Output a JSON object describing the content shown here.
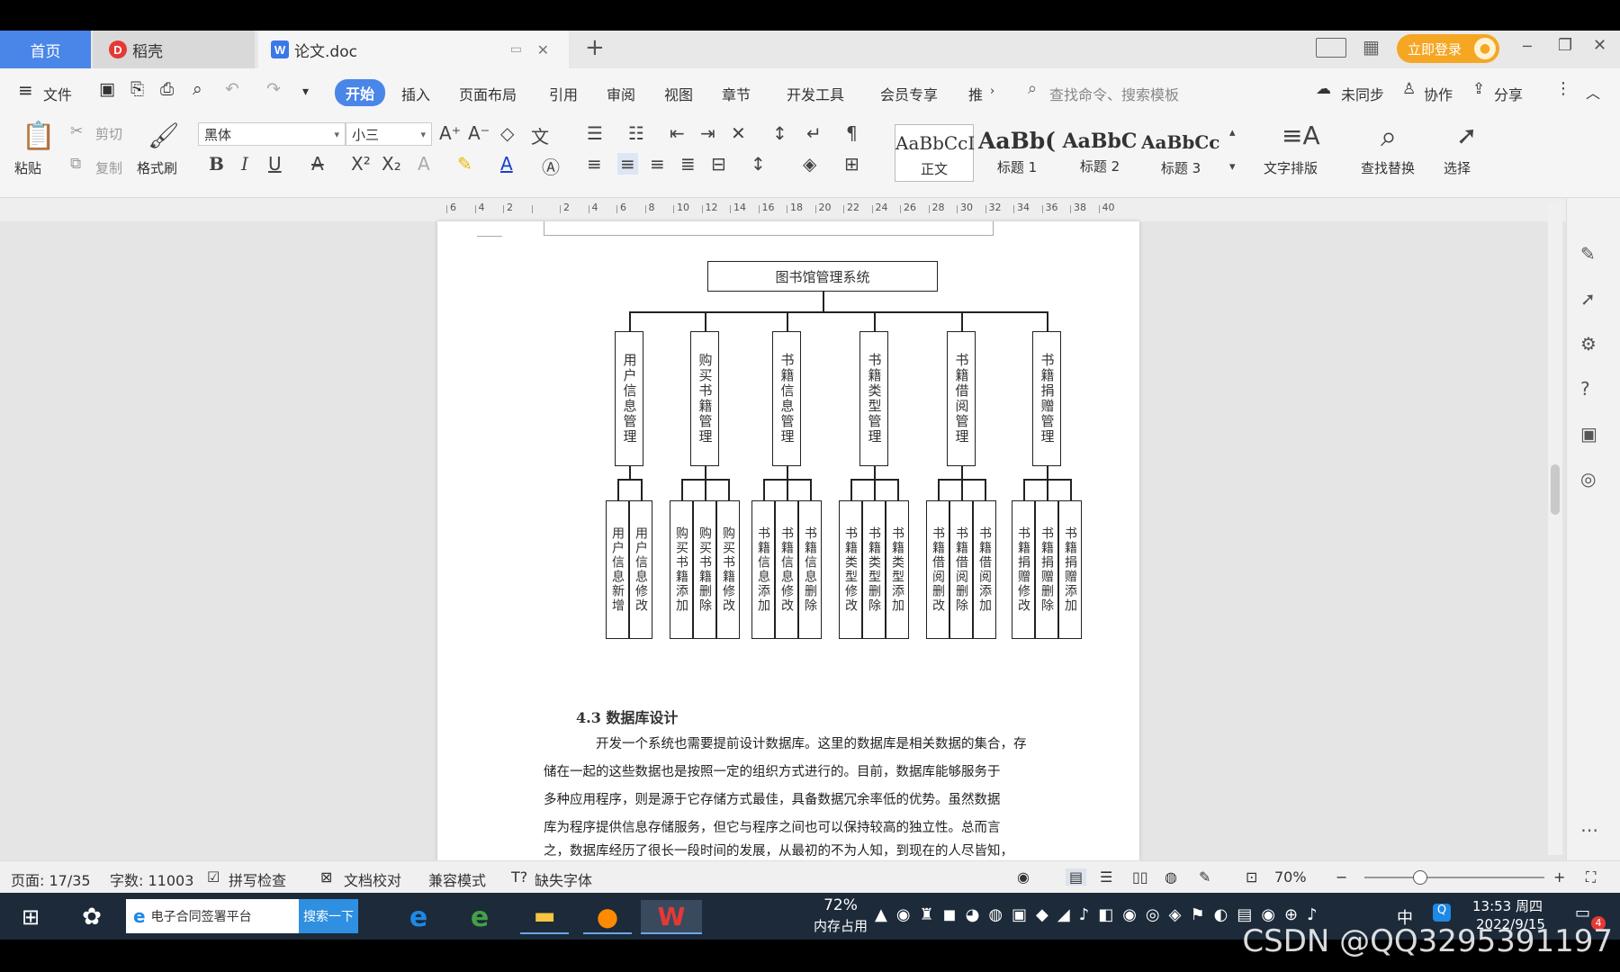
{
  "tabs": {
    "home": "首页",
    "daoke": "稻壳",
    "doc": "论文.doc",
    "new_tab": "+"
  },
  "window": {
    "login": "立即登录",
    "minimize": "─",
    "restore": "❐",
    "close": "✕"
  },
  "menu": {
    "file": "文件",
    "items": [
      "开始",
      "插入",
      "页面布局",
      "引用",
      "审阅",
      "视图",
      "章节",
      "开发工具",
      "会员专享",
      "推"
    ],
    "search_placeholder": "查找命令、搜索模板",
    "sync": "未同步",
    "collab": "协作",
    "share": "分享"
  },
  "ribbon": {
    "paste": "粘贴",
    "cut": "剪切",
    "copy": "复制",
    "format_painter": "格式刷",
    "font_name": "黑体",
    "font_size": "小三",
    "styles": [
      {
        "preview": "AaBbCcI",
        "name": "正文"
      },
      {
        "preview": "AaBb(",
        "name": "标题 1"
      },
      {
        "preview": "AaBbC",
        "name": "标题 2"
      },
      {
        "preview": "AaBbCcl",
        "name": "标题 3"
      }
    ],
    "text_layout": "文字排版",
    "find_replace": "查找替换",
    "select": "选择"
  },
  "ruler": {
    "ticks": [
      "6",
      "4",
      "2",
      "",
      "2",
      "4",
      "6",
      "8",
      "10",
      "12",
      "14",
      "16",
      "18",
      "20",
      "22",
      "24",
      "26",
      "28",
      "30",
      "32",
      "34",
      "36",
      "38",
      "40"
    ]
  },
  "diagram": {
    "root": "图书馆管理系统",
    "modules": [
      {
        "name": "用户信息管理",
        "children": [
          "用户信息新增",
          "用户信息修改"
        ]
      },
      {
        "name": "购买书籍管理",
        "children": [
          "购买书籍添加",
          "购买书籍删除",
          "购买书籍修改"
        ]
      },
      {
        "name": "书籍信息管理",
        "children": [
          "书籍信息添加",
          "书籍信息修改",
          "书籍信息删除"
        ]
      },
      {
        "name": "书籍类型管理",
        "children": [
          "书籍类型修改",
          "书籍类型删除",
          "书籍类型添加"
        ]
      },
      {
        "name": "书籍借阅管理",
        "children": [
          "书籍借阅删改",
          "书籍借阅删除",
          "书籍借阅添加"
        ]
      },
      {
        "name": "书籍捐赠管理",
        "children": [
          "书籍捐赠修改",
          "书籍捐赠删除",
          "书籍捐赠添加"
        ]
      }
    ]
  },
  "document": {
    "heading": "4.3  数据库设计",
    "lines": [
      "开发一个系统也需要提前设计数据库。这里的数据库是相关数据的集合，存",
      "储在一起的这些数据也是按照一定的组织方式进行的。目前，数据库能够服务于",
      "多种应用程序，则是源于它存储方式最佳，具备数据冗余率低的优势。虽然数据",
      "库为程序提供信息存储服务，但它与程序之间也可以保持较高的独立性。总而言",
      "之，数据库经历了很长一段时间的发展，从最初的不为人知，到现在的人尽皆知，"
    ]
  },
  "status": {
    "page": "页面: 17/35",
    "words": "字数: 11003",
    "spell": "拼写检查",
    "proof": "文档校对",
    "compat": "兼容模式",
    "missing_font": "缺失字体",
    "zoom": "70%"
  },
  "taskbar": {
    "search_text": "电子合同签署平台",
    "search_button": "搜索一下",
    "mem_percent": "72%",
    "mem_label": "内存占用",
    "ime": "中",
    "time": "13:53 周四",
    "date": "2022/9/15",
    "notif_count": "4"
  },
  "watermark": "CSDN @QQ3295391197",
  "colors": {
    "accent": "#4a86e8",
    "login": "#f5a623",
    "taskbar": "#1c2a3a"
  }
}
